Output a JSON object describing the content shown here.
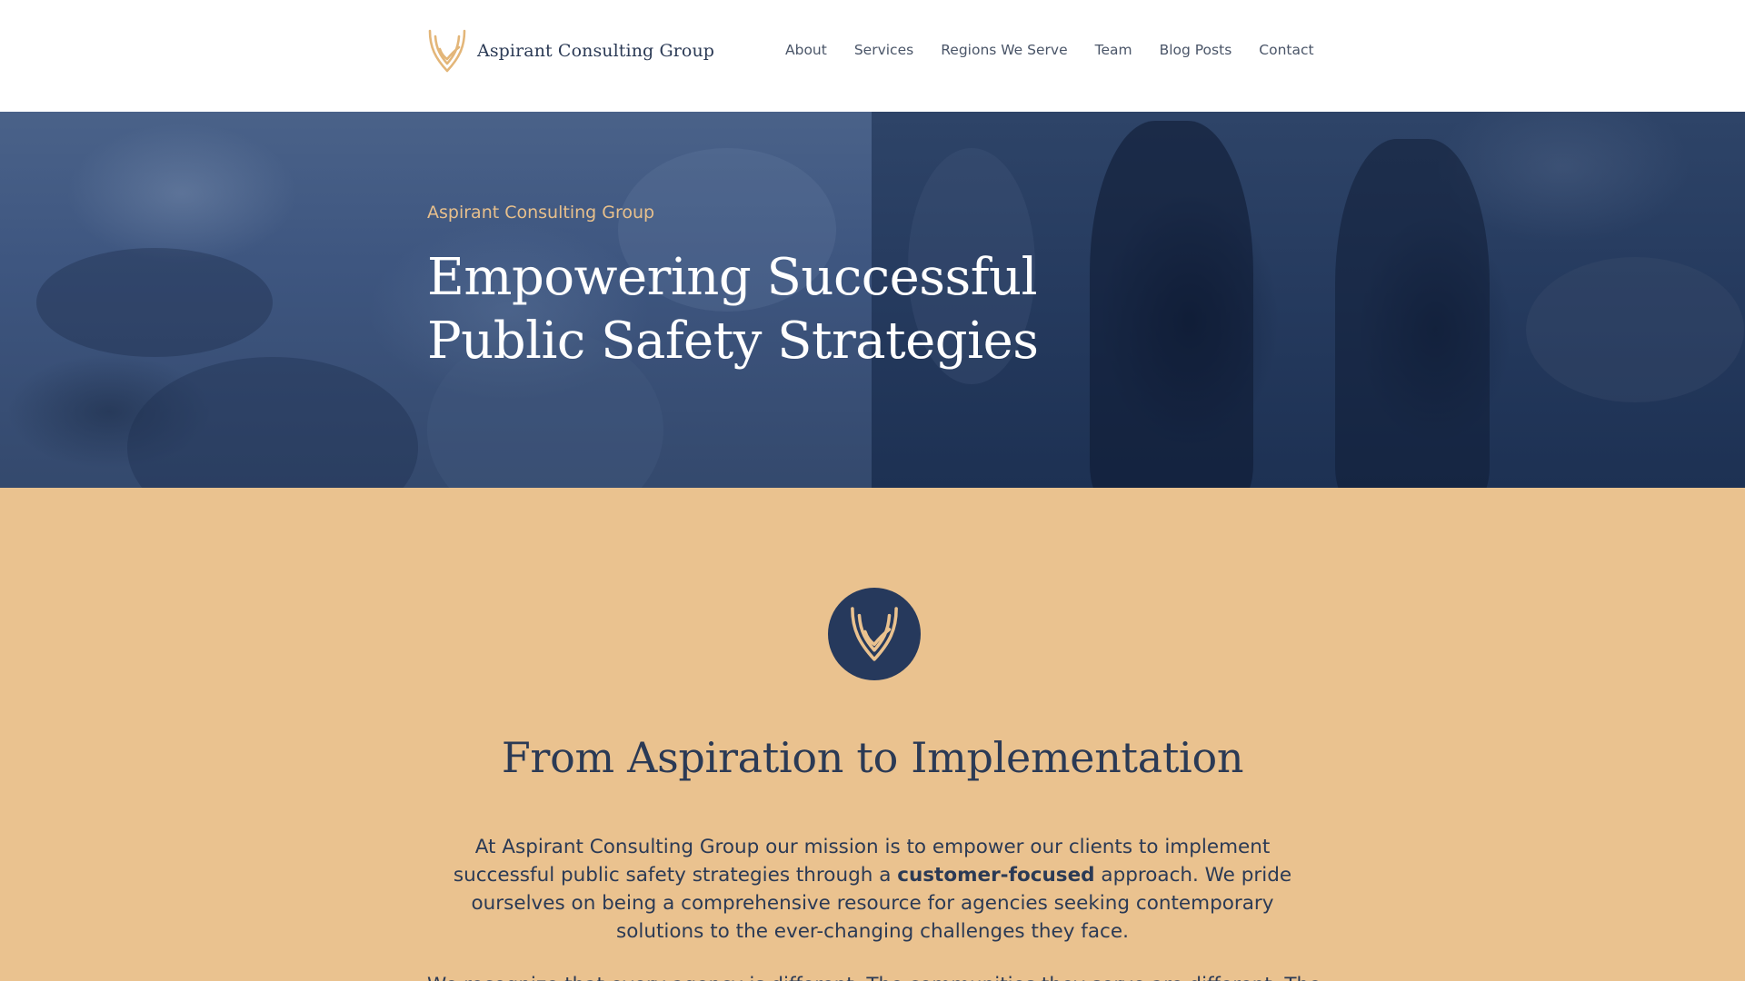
{
  "header": {
    "brand_name": "Aspirant Consulting Group",
    "nav": [
      {
        "label": "About"
      },
      {
        "label": "Services"
      },
      {
        "label": "Regions We Serve"
      },
      {
        "label": "Team"
      },
      {
        "label": "Blog Posts"
      },
      {
        "label": "Contact"
      }
    ]
  },
  "hero": {
    "eyebrow": "Aspirant Consulting Group",
    "title_line1": "Empowering Successful",
    "title_line2": "Public Safety Strategies"
  },
  "mission": {
    "emblem_icon": "aspirant-logo-icon",
    "title": "From Aspiration to Implementation",
    "text_before": "At Aspirant Consulting Group our mission is to empower our clients to implement successful public safety strategies through a ",
    "text_bold": "customer-focused",
    "text_after": " approach. We pride ourselves on being a comprehensive resource for agencies seeking contemporary solutions to the ever-changing challenges they face.",
    "text_next": "We recognize that every agency is different. The communities they serve are different. Their"
  },
  "colors": {
    "navy": "#26395c",
    "gold": "#eac28f",
    "accent_text": "#e8c08c"
  }
}
